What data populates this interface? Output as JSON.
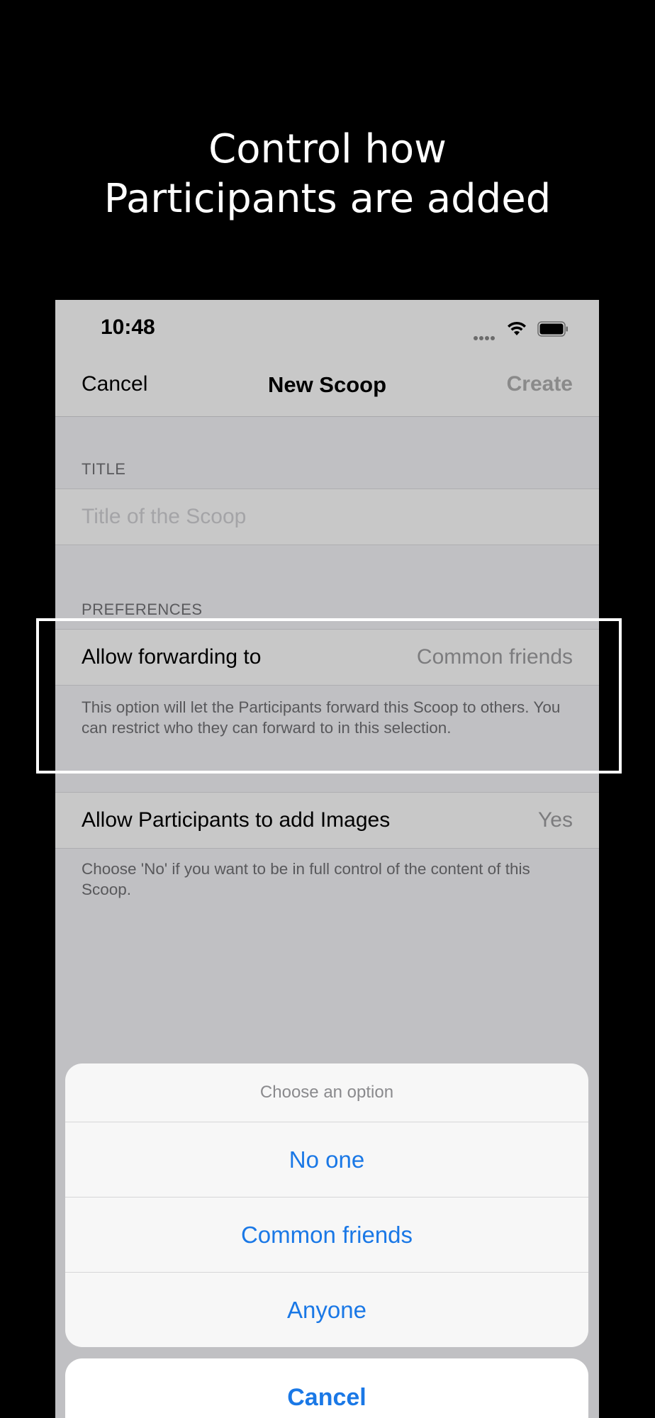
{
  "headline": {
    "line1": "Control how",
    "line2": "Participants are added"
  },
  "status_bar": {
    "time": "10:48",
    "icons": [
      "signal-icon",
      "wifi-icon",
      "battery-icon"
    ]
  },
  "nav": {
    "cancel_label": "Cancel",
    "title": "New Scoop",
    "create_label": "Create"
  },
  "form": {
    "title_section_header": "TITLE",
    "title_placeholder": "Title of the Scoop",
    "preferences_header": "PREFERENCES",
    "forwarding": {
      "label": "Allow forwarding to",
      "value": "Common friends",
      "footnote": "This option will let the Participants forward this Scoop to others. You can restrict who they can forward to in this selection."
    },
    "images": {
      "label": "Allow Participants to add Images",
      "value": "Yes",
      "footnote": "Choose 'No' if you want to be in full control of the content of this Scoop."
    }
  },
  "action_sheet": {
    "title": "Choose an option",
    "options": [
      "No one",
      "Common friends",
      "Anyone"
    ],
    "cancel_label": "Cancel"
  },
  "colors": {
    "accent": "#1a78e6",
    "background": "#000000",
    "screen_dim": "#c0c0c3"
  }
}
